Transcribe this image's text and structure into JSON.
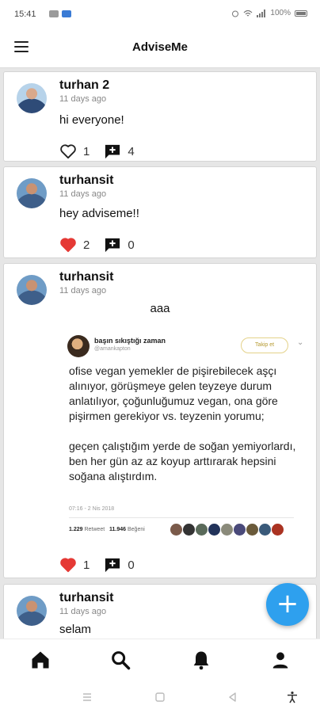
{
  "status_bar": {
    "time": "15:41",
    "battery": "100%"
  },
  "app_bar": {
    "title": "AdviseMe"
  },
  "posts": [
    {
      "username": "turhan 2",
      "time": "11 days ago",
      "text": "hi everyone!",
      "likes": "1",
      "comments": "4",
      "liked": false
    },
    {
      "username": "turhansit",
      "time": "11 days ago",
      "text": "hey adviseme!!",
      "likes": "2",
      "comments": "0",
      "liked": true
    },
    {
      "username": "turhansit",
      "time": "11 days ago",
      "text": "aaa",
      "likes": "1",
      "comments": "0",
      "liked": true,
      "embed": {
        "author_name": "başın sıkıştığı zaman",
        "author_handle": "@amankapton",
        "follow_label": "Takip et",
        "paragraph1": "ofise vegan yemekler de pişirebilecek aşçı alınıyor, görüşmeye gelen teyzeye durum anlatılıyor, çoğunluğumuz vegan, ona göre pişirmen gerekiyor vs.  teyzenin yorumu;",
        "paragraph2": "geçen çalıştığım yerde de soğan yemiyorlardı, ben her gün az az koyup arttırarak hepsini soğana alıştırdım.",
        "date": "07:16 - 2 Nis 2018",
        "retweets": "1.229",
        "retweets_label": "Retweet",
        "likes": "11.946",
        "likes_label": "Beğeni"
      }
    },
    {
      "username": "turhansit",
      "time": "11 days ago",
      "text": "selam"
    }
  ],
  "fab": {
    "label": "+"
  },
  "colors": {
    "accent": "#2ea0ee",
    "like_active": "#e53935",
    "text": "#111111",
    "muted": "#888888"
  },
  "icons": {
    "menu": "hamburger-icon",
    "like": "heart-icon",
    "comment": "comment-icon",
    "home": "home-icon",
    "search": "search-icon",
    "notifications": "bell-icon",
    "profile": "person-icon"
  }
}
